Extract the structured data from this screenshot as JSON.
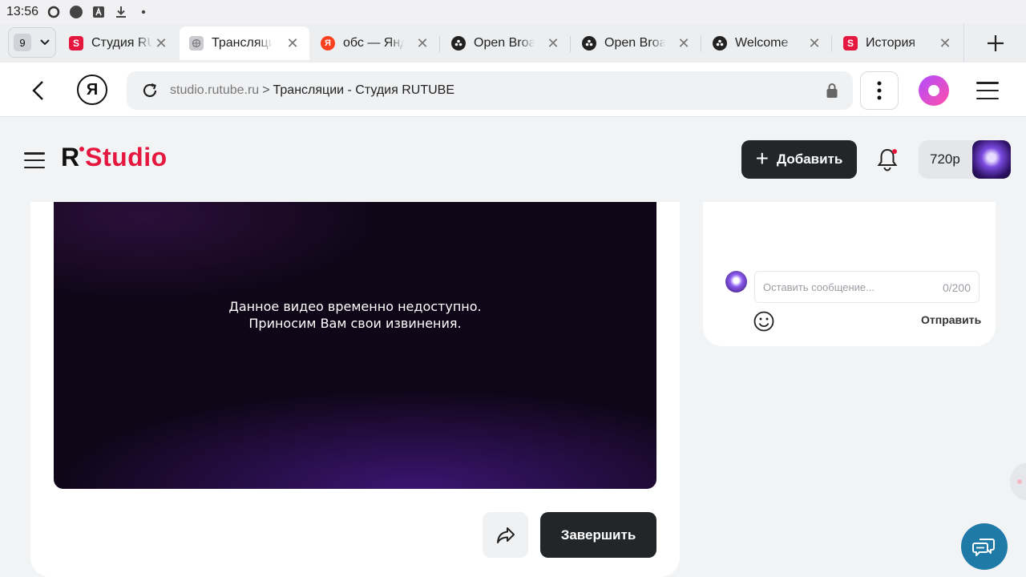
{
  "status_bar": {
    "time": "13:56",
    "icons": [
      "sync-icon",
      "record-dot-icon",
      "app-a-icon",
      "download-icon",
      "more-dot-icon"
    ]
  },
  "tabs": {
    "count": "9",
    "items": [
      {
        "title": "Студия RUTUBE",
        "favicon": "rutube-icon",
        "active": false
      },
      {
        "title": "Трансляции",
        "favicon": "globe-icon",
        "active": true
      },
      {
        "title": "обс — Яндекс",
        "favicon": "yandex-icon",
        "active": false
      },
      {
        "title": "Open Broadcaster",
        "favicon": "obs-icon",
        "active": false
      },
      {
        "title": "Open Broadcaster",
        "favicon": "obs-icon",
        "active": false
      },
      {
        "title": "Welcome",
        "favicon": "obs-icon",
        "active": false
      },
      {
        "title": "История",
        "favicon": "rutube-icon",
        "active": false
      }
    ]
  },
  "address_bar": {
    "host": "studio.rutube.ru",
    "separator": ">",
    "page_title": "Трансляции - Студия RUTUBE",
    "yandex_letter": "Я"
  },
  "site_header": {
    "logo_r": "R",
    "logo_studio": "Studio",
    "add_button": "Добавить",
    "quality": "720p"
  },
  "player": {
    "message_line1": "Данное видео временно недоступно.",
    "message_line2": "Приносим Вам свои извинения."
  },
  "actions": {
    "finish_button": "Завершить"
  },
  "chat": {
    "placeholder": "Оставить сообщение...",
    "counter": "0/200",
    "send_label": "Отправить"
  },
  "colors": {
    "brand_red": "#e5173f",
    "dark_button": "#232629",
    "support_button": "#1f7aa8"
  }
}
